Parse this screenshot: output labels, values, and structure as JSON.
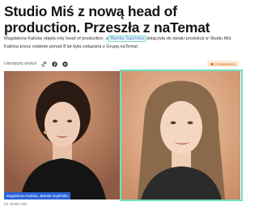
{
  "article": {
    "headline": "Studio Miś z nową head of production. Przeszła z naTemat",
    "lead_part1": "Magdalena Kalicka objęła rolę head of production, a ",
    "lead_highlight": "Bianka Gąsińska",
    "lead_part2": " dołączyła do działu produkcji w Studiu Miś. Kalicka przez ostatnie ponad 8 lat była związana z Grupą naTemat.",
    "sponsored_label": "Udostępnij artykuł",
    "comments_label": "0 komentarzy",
    "photo_caption": "Magdalena Kalicka, Bianka Gąsińska",
    "photo_credit": "fot. Studio Miś"
  },
  "colors": {
    "highlight": "#6fe0c4",
    "caption_badge": "#2a63d8",
    "comments_accent": "#f07a1a"
  },
  "icons": [
    "link-icon",
    "facebook-icon",
    "twitter-icon"
  ]
}
